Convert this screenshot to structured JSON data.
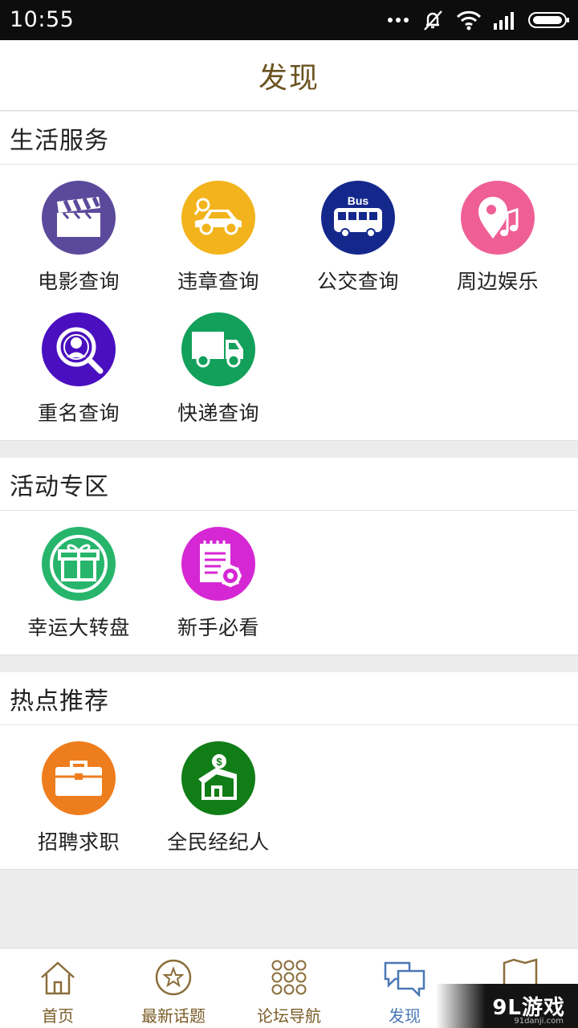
{
  "status_bar": {
    "time": "10:55"
  },
  "header": {
    "title": "发现"
  },
  "sections": [
    {
      "title": "生活服务",
      "items": [
        {
          "label": "电影查询",
          "icon": "movie-clapper-icon",
          "color": "#5b4a9b"
        },
        {
          "label": "违章查询",
          "icon": "car-icon",
          "color": "#f2b31c"
        },
        {
          "label": "公交查询",
          "icon": "bus-icon",
          "color": "#14288c",
          "icon_text": "Bus"
        },
        {
          "label": "周边娱乐",
          "icon": "location-music-icon",
          "color": "#ef5f95"
        },
        {
          "label": "重名查询",
          "icon": "person-search-icon",
          "color": "#4a0fbf"
        },
        {
          "label": "快递查询",
          "icon": "truck-icon",
          "color": "#12a05a"
        }
      ]
    },
    {
      "title": "活动专区",
      "items": [
        {
          "label": "幸运大转盘",
          "icon": "gift-icon",
          "color": "#27b56c"
        },
        {
          "label": "新手必看",
          "icon": "notepad-gear-icon",
          "color": "#d627d4"
        }
      ]
    },
    {
      "title": "热点推荐",
      "items": [
        {
          "label": "招聘求职",
          "icon": "briefcase-icon",
          "color": "#ee7d1d"
        },
        {
          "label": "全民经纪人",
          "icon": "house-money-icon",
          "color": "#117d17"
        }
      ]
    }
  ],
  "bottom_nav": [
    {
      "label": "首页",
      "icon": "home-icon",
      "active": false
    },
    {
      "label": "最新话题",
      "icon": "star-circle-icon",
      "active": false
    },
    {
      "label": "论坛导航",
      "icon": "grid-dots-icon",
      "active": false
    },
    {
      "label": "发现",
      "icon": "chat-bubbles-icon",
      "active": true
    },
    {
      "label": "",
      "icon": "map-icon",
      "active": false
    }
  ],
  "watermark": {
    "text": "9L游戏",
    "sub": "91danji.com"
  },
  "colors": {
    "title": "#6b5320",
    "nav_label": "#7a5c26",
    "nav_active": "#4a78b5"
  }
}
